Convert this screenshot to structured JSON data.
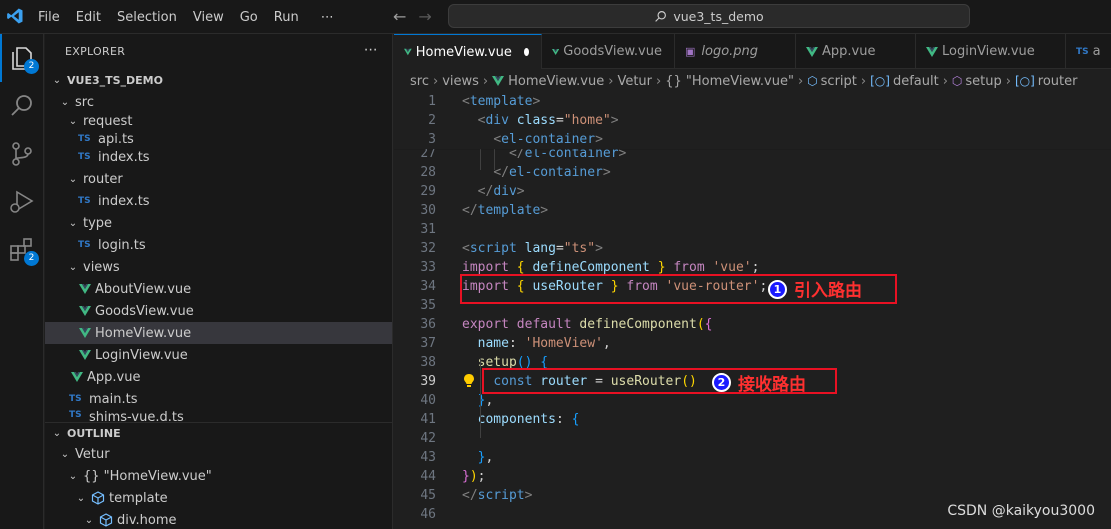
{
  "menu": [
    "File",
    "Edit",
    "Selection",
    "View",
    "Go",
    "Run",
    "⋯"
  ],
  "search": {
    "text": "vue3_ts_demo"
  },
  "badges": {
    "explorer": "2",
    "extensions": "2"
  },
  "explorer": {
    "title": "EXPLORER",
    "more": "⋯",
    "root": "VUE3_TS_DEMO",
    "items": [
      {
        "label": "src",
        "kind": "folder-open"
      },
      {
        "label": "request",
        "kind": "folder-open"
      },
      {
        "label": "api.ts",
        "kind": "ts"
      },
      {
        "label": "index.ts",
        "kind": "ts"
      },
      {
        "label": "router",
        "kind": "folder-open"
      },
      {
        "label": "index.ts",
        "kind": "ts"
      },
      {
        "label": "type",
        "kind": "folder-open"
      },
      {
        "label": "login.ts",
        "kind": "ts"
      },
      {
        "label": "views",
        "kind": "folder-open"
      },
      {
        "label": "AboutView.vue",
        "kind": "vue"
      },
      {
        "label": "GoodsView.vue",
        "kind": "vue"
      },
      {
        "label": "HomeView.vue",
        "kind": "vue"
      },
      {
        "label": "LoginView.vue",
        "kind": "vue"
      },
      {
        "label": "App.vue",
        "kind": "vue"
      },
      {
        "label": "main.ts",
        "kind": "ts"
      },
      {
        "label": "shims-vue.d.ts",
        "kind": "ts"
      }
    ]
  },
  "outline": {
    "title": "OUTLINE",
    "items": [
      {
        "label": "Vetur"
      },
      {
        "label": "{} \"HomeView.vue\""
      },
      {
        "label": "template"
      },
      {
        "label": "div.home"
      }
    ]
  },
  "tabs": [
    {
      "label": "HomeView.vue",
      "active": true,
      "modified": true
    },
    {
      "label": "GoodsView.vue"
    },
    {
      "label": "logo.png"
    },
    {
      "label": "App.vue"
    },
    {
      "label": "LoginView.vue"
    },
    {
      "label": "a",
      "ts": "TS"
    }
  ],
  "breadcrumbs": [
    "src",
    "views",
    "HomeView.vue",
    "Vetur",
    "{} \"HomeView.vue\"",
    "script",
    "default",
    "setup",
    "router"
  ],
  "editor": {
    "lines": [
      {
        "n": "1",
        "tokens": [
          [
            "t-punc",
            "<"
          ],
          [
            "t-tag",
            "template"
          ],
          [
            "t-punc",
            ">"
          ]
        ]
      },
      {
        "n": "2",
        "tokens": [
          [
            "t-txt",
            "  "
          ],
          [
            "t-punc",
            "<"
          ],
          [
            "t-tag",
            "div"
          ],
          [
            "t-txt",
            " "
          ],
          [
            "t-attr",
            "class"
          ],
          [
            "t-txt",
            "="
          ],
          [
            "t-str",
            "\"home\""
          ],
          [
            "t-punc",
            ">"
          ]
        ]
      },
      {
        "n": "3",
        "tokens": [
          [
            "t-txt",
            "    "
          ],
          [
            "t-punc",
            "<"
          ],
          [
            "t-tag",
            "el-container"
          ],
          [
            "t-punc",
            ">"
          ]
        ]
      },
      {
        "n": "27",
        "tokens": [
          [
            "t-txt",
            "      "
          ],
          [
            "t-punc",
            "</"
          ],
          [
            "t-tag",
            "el-container"
          ],
          [
            "t-punc",
            ">"
          ]
        ]
      },
      {
        "n": "28",
        "tokens": [
          [
            "t-txt",
            "    "
          ],
          [
            "t-punc",
            "</"
          ],
          [
            "t-tag",
            "el-container"
          ],
          [
            "t-punc",
            ">"
          ]
        ]
      },
      {
        "n": "29",
        "tokens": [
          [
            "t-txt",
            "  "
          ],
          [
            "t-punc",
            "</"
          ],
          [
            "t-tag",
            "div"
          ],
          [
            "t-punc",
            ">"
          ]
        ]
      },
      {
        "n": "30",
        "tokens": [
          [
            "t-punc",
            "</"
          ],
          [
            "t-tag",
            "template"
          ],
          [
            "t-punc",
            ">"
          ]
        ]
      },
      {
        "n": "31",
        "tokens": []
      },
      {
        "n": "32",
        "tokens": [
          [
            "t-punc",
            "<"
          ],
          [
            "t-tag",
            "script"
          ],
          [
            "t-txt",
            " "
          ],
          [
            "t-attr",
            "lang"
          ],
          [
            "t-txt",
            "="
          ],
          [
            "t-str",
            "\"ts\""
          ],
          [
            "t-punc",
            ">"
          ]
        ]
      },
      {
        "n": "33",
        "tokens": [
          [
            "t-kw",
            "import"
          ],
          [
            "t-txt",
            " "
          ],
          [
            "t-brk3",
            "{"
          ],
          [
            "t-txt",
            " "
          ],
          [
            "t-var",
            "defineComponent"
          ],
          [
            "t-txt",
            " "
          ],
          [
            "t-brk3",
            "}"
          ],
          [
            "t-txt",
            " "
          ],
          [
            "t-kw",
            "from"
          ],
          [
            "t-txt",
            " "
          ],
          [
            "t-str",
            "'vue'"
          ],
          [
            "t-txt",
            ";"
          ]
        ]
      },
      {
        "n": "34",
        "tokens": [
          [
            "t-kw",
            "import"
          ],
          [
            "t-txt",
            " "
          ],
          [
            "t-brk3",
            "{"
          ],
          [
            "t-txt",
            " "
          ],
          [
            "t-var",
            "useRouter"
          ],
          [
            "t-txt",
            " "
          ],
          [
            "t-brk3",
            "}"
          ],
          [
            "t-txt",
            " "
          ],
          [
            "t-kw",
            "from"
          ],
          [
            "t-txt",
            " "
          ],
          [
            "t-str",
            "'vue-router'"
          ],
          [
            "t-txt",
            ";"
          ]
        ]
      },
      {
        "n": "35",
        "tokens": []
      },
      {
        "n": "36",
        "tokens": [
          [
            "t-kw",
            "export"
          ],
          [
            "t-txt",
            " "
          ],
          [
            "t-kw",
            "default"
          ],
          [
            "t-txt",
            " "
          ],
          [
            "t-fn",
            "defineComponent"
          ],
          [
            "t-brk3",
            "("
          ],
          [
            "t-brk",
            "{"
          ]
        ]
      },
      {
        "n": "37",
        "tokens": [
          [
            "t-txt",
            "  "
          ],
          [
            "t-var",
            "name"
          ],
          [
            "t-txt",
            ": "
          ],
          [
            "t-str",
            "'HomeView'"
          ],
          [
            "t-txt",
            ","
          ]
        ]
      },
      {
        "n": "38",
        "tokens": [
          [
            "t-txt",
            "  "
          ],
          [
            "t-fn",
            "setup"
          ],
          [
            "t-brk2",
            "()"
          ],
          [
            "t-txt",
            " "
          ],
          [
            "t-brk2",
            "{"
          ]
        ]
      },
      {
        "n": "39",
        "tokens": [
          [
            "t-txt",
            "    "
          ],
          [
            "t-blue",
            "const"
          ],
          [
            "t-txt",
            " "
          ],
          [
            "t-var",
            "router"
          ],
          [
            "t-txt",
            " = "
          ],
          [
            "t-fn",
            "useRouter"
          ],
          [
            "t-brk3",
            "()"
          ]
        ]
      },
      {
        "n": "40",
        "tokens": [
          [
            "t-txt",
            "  "
          ],
          [
            "t-brk2",
            "}"
          ],
          [
            "t-txt",
            ","
          ]
        ]
      },
      {
        "n": "41",
        "tokens": [
          [
            "t-txt",
            "  "
          ],
          [
            "t-var",
            "components"
          ],
          [
            "t-txt",
            ": "
          ],
          [
            "t-brk2",
            "{"
          ]
        ]
      },
      {
        "n": "42",
        "tokens": []
      },
      {
        "n": "43",
        "tokens": [
          [
            "t-txt",
            "  "
          ],
          [
            "t-brk2",
            "}"
          ],
          [
            "t-txt",
            ","
          ]
        ]
      },
      {
        "n": "44",
        "tokens": [
          [
            "t-brk",
            "}"
          ],
          [
            "t-brk3",
            ")"
          ],
          [
            "t-txt",
            ";"
          ]
        ]
      },
      {
        "n": "45",
        "tokens": [
          [
            "t-punc",
            "</"
          ],
          [
            "t-tag",
            "script"
          ],
          [
            "t-punc",
            ">"
          ]
        ]
      },
      {
        "n": "46",
        "tokens": []
      }
    ]
  },
  "annotations": [
    {
      "num": "1",
      "text": "引入路由"
    },
    {
      "num": "2",
      "text": "接收路由"
    }
  ],
  "watermark": "CSDN @kaikyou3000"
}
